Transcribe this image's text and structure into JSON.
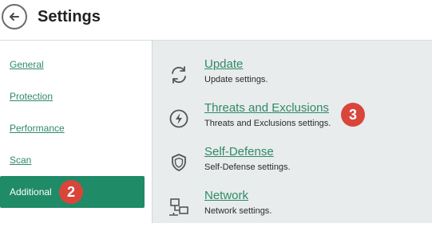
{
  "header": {
    "title": "Settings",
    "back_icon": "arrow-left-icon"
  },
  "sidebar": {
    "items": [
      {
        "label": "General"
      },
      {
        "label": "Protection"
      },
      {
        "label": "Performance"
      },
      {
        "label": "Scan"
      },
      {
        "label": "Additional",
        "active": true
      }
    ],
    "active_badge": "2"
  },
  "main": {
    "rows": [
      {
        "title": "Update",
        "description": "Update settings.",
        "icon": "refresh-icon"
      },
      {
        "title": "Threats and Exclusions",
        "description": "Threats and Exclusions settings.",
        "icon": "lightning-bolt-icon"
      },
      {
        "title": "Self-Defense",
        "description": "Self-Defense settings.",
        "icon": "shield-icon"
      },
      {
        "title": "Network",
        "description": "Network settings.",
        "icon": "network-icon"
      }
    ],
    "row_badge": "3"
  },
  "colors": {
    "accent": "#1f8b67",
    "link": "#2f8a66",
    "badge": "#d9453b",
    "panel_bg": "#e8ecec"
  }
}
